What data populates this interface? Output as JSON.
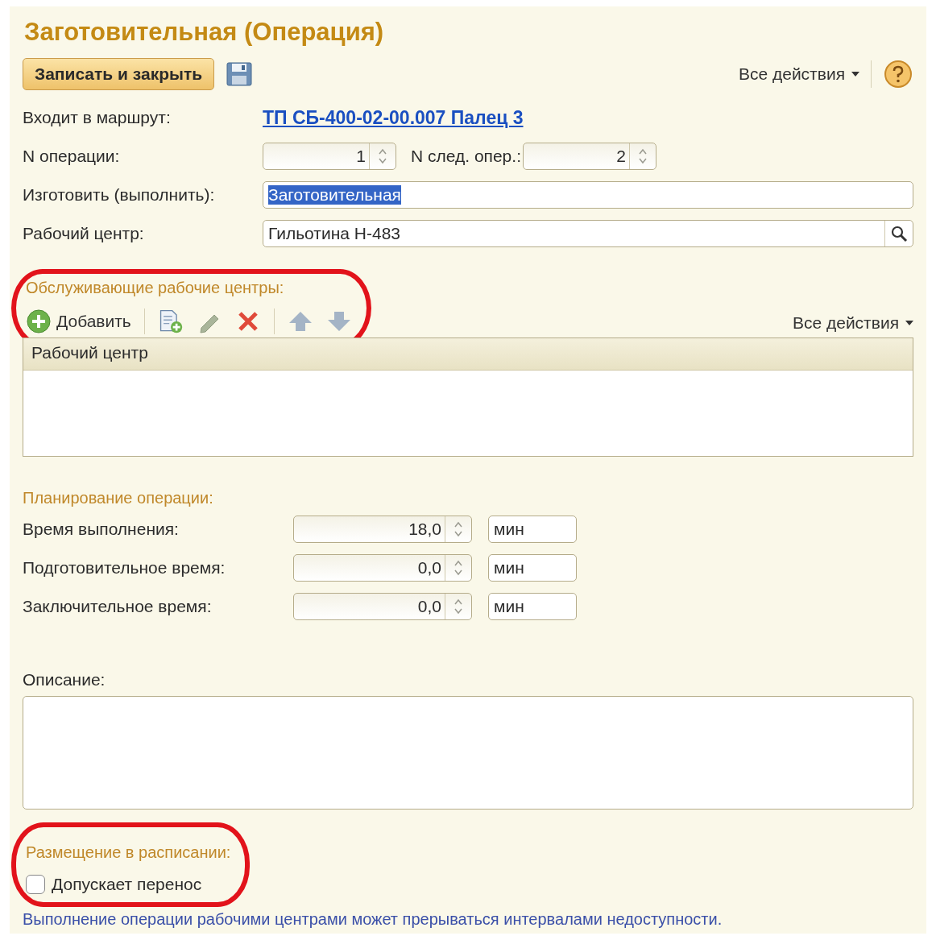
{
  "window": {
    "title": "Заготовительная (Операция)"
  },
  "toolbar": {
    "save_close_button": "Записать и закрыть",
    "all_actions": "Все действия"
  },
  "fields": [
    {
      "kind": "link",
      "label": "Входит в маршрут:",
      "value": "ТП СБ-400-02-00.007 Палец 3"
    },
    {
      "kind": "spin-pair",
      "label": "N операции:",
      "value": "1",
      "second_label": "N след. опер.:",
      "second_value": "2"
    },
    {
      "kind": "text",
      "label": "Изготовить (выполнить):",
      "value": "Заготовительная",
      "selected": true
    },
    {
      "kind": "lookup",
      "label": "Рабочий центр:",
      "value": "Гильотина Н-483"
    }
  ],
  "services": {
    "title": "Обслуживающие рабочие центры:",
    "highlighted": true,
    "add_button": "Добавить",
    "all_actions": "Все действия",
    "table": {
      "columns": [
        "Рабочий центр"
      ]
    }
  },
  "planning": {
    "title": "Планирование операции:",
    "rows": [
      {
        "label": "Время выполнения:",
        "value": "18,0",
        "unit": "мин"
      },
      {
        "label": "Подготовительное время:",
        "value": "0,0",
        "unit": "мин"
      },
      {
        "label": "Заключительное время:",
        "value": "0,0",
        "unit": "мин"
      }
    ]
  },
  "description": {
    "label": "Описание:"
  },
  "schedule": {
    "title": "Размещение в расписании:",
    "highlighted": true,
    "checkbox": {
      "label": "Допускает перенос",
      "checked": false
    },
    "note": "Выполнение операции рабочими центрами может прерываться интервалами недоступности."
  }
}
